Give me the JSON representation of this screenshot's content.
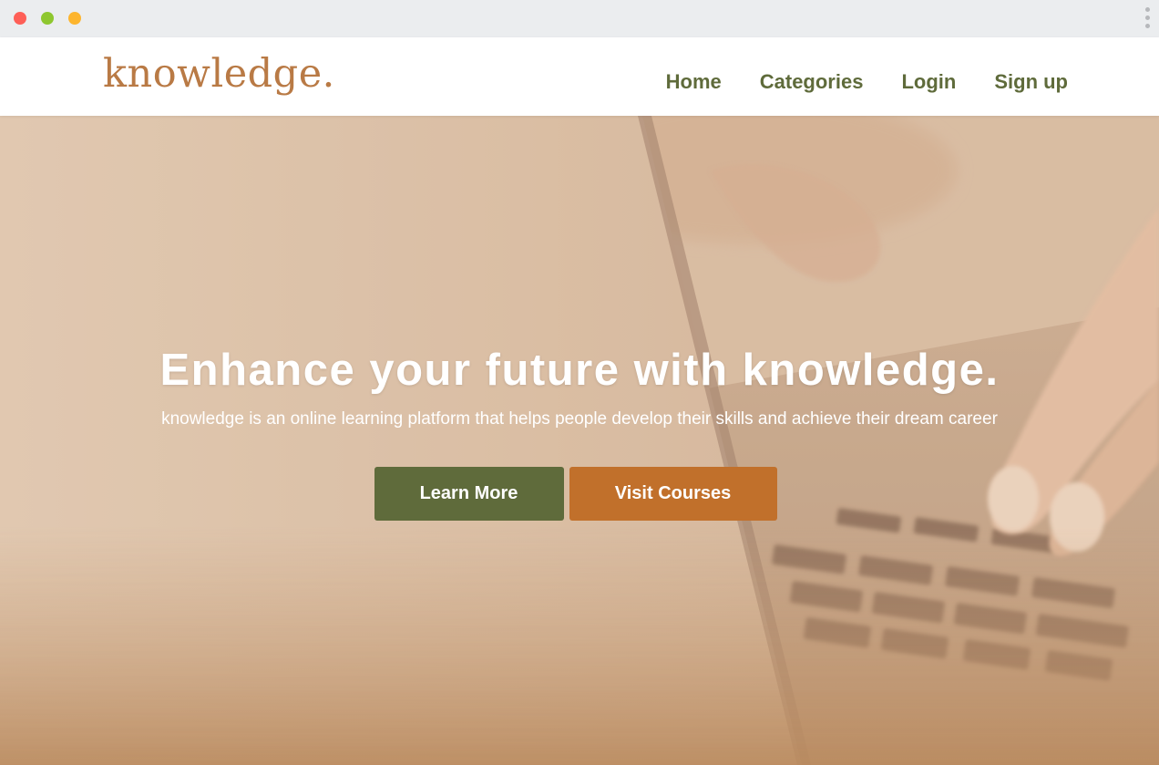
{
  "browser": {
    "traffic_lights": [
      "close",
      "minimize",
      "zoom"
    ]
  },
  "nav": {
    "logo": "knowledge.",
    "links": [
      "Home",
      "Categories",
      "Login",
      "Sign up"
    ]
  },
  "hero": {
    "title": "Enhance your future with knowledge.",
    "subtitle": "knowledge is an online learning platform that helps people develop their skills and achieve their dream career",
    "buttons": {
      "primary": "Learn More",
      "secondary": "Visit Courses"
    }
  },
  "colors": {
    "brand": "#b97a45",
    "nav_text": "#5f6b3b",
    "primary_button": "#5f6b3b",
    "secondary_button": "#c1702b"
  }
}
